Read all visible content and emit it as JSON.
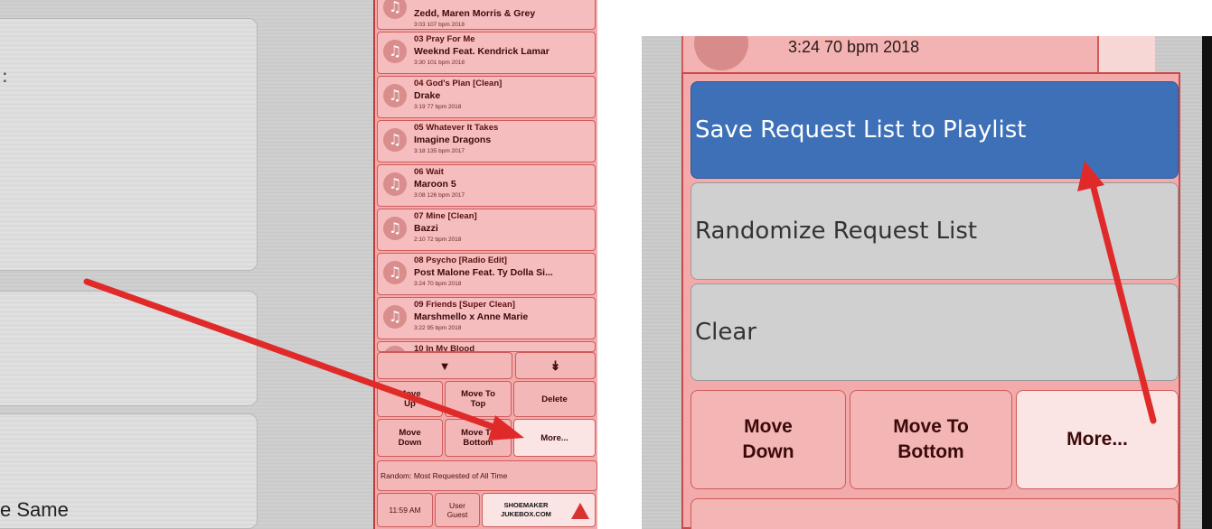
{
  "left_view": {
    "caption": "e Same",
    "colon_fragment": ":",
    "queue": [
      {
        "title": "",
        "artist": "Zedd, Maren Morris & Grey",
        "meta": "3:03  107 bpm  2018"
      },
      {
        "title": "03 Pray For Me",
        "artist": "Weeknd Feat. Kendrick Lamar",
        "meta": "3:30  101 bpm  2018"
      },
      {
        "title": "04 God's Plan [Clean]",
        "artist": "Drake",
        "meta": "3:19  77 bpm  2018"
      },
      {
        "title": "05 Whatever It Takes",
        "artist": "Imagine Dragons",
        "meta": "3:18  135 bpm  2017"
      },
      {
        "title": "06 Wait",
        "artist": "Maroon 5",
        "meta": "3:08  126 bpm  2017"
      },
      {
        "title": "07 Mine [Clean]",
        "artist": "Bazzi",
        "meta": "2:10  72 bpm  2018"
      },
      {
        "title": "08 Psycho [Radio Edit]",
        "artist": "Post Malone Feat. Ty Dolla Si...",
        "meta": "3:24  70 bpm  2018"
      },
      {
        "title": "09 Friends [Super Clean]",
        "artist": "Marshmello x Anne Marie",
        "meta": "3:22  95 bpm  2018"
      },
      {
        "title": "10 In My Blood",
        "artist": "",
        "meta": ""
      }
    ],
    "scroll_down_glyph": "▼",
    "scroll_bottom_glyph": "↡",
    "buttons": {
      "move_up": "Move\nUp",
      "move_to_top": "Move To\nTop",
      "delete": "Delete",
      "move_down": "Move\nDown",
      "move_to_bottom": "Move To\nBottom",
      "more": "More..."
    },
    "status": "Random: Most Requested of All Time",
    "footer": {
      "time": "11:59 AM",
      "user": "User\nGuest",
      "brand": "SHOEMAKER\nJUKEBOX.COM"
    }
  },
  "right_view": {
    "top_item_meta": "3:24   70 bpm   2018",
    "menu_options": [
      {
        "label": "Save Request List to Playlist",
        "selected": true
      },
      {
        "label": "Randomize Request List",
        "selected": false
      },
      {
        "label": "Clear",
        "selected": false
      }
    ],
    "buttons": {
      "move_down": "Move\nDown",
      "move_to_bottom": "Move To\nBottom",
      "more": "More..."
    }
  },
  "colors": {
    "queue_pink": "#f5bdbd",
    "border_red": "#cf5a5a",
    "selected_blue": "#3e70b8",
    "annotation_arrow_red": "#e02a2a"
  },
  "annotations": [
    "arrow pointing to More... button",
    "arrow pointing to Save Request List to Playlist"
  ]
}
